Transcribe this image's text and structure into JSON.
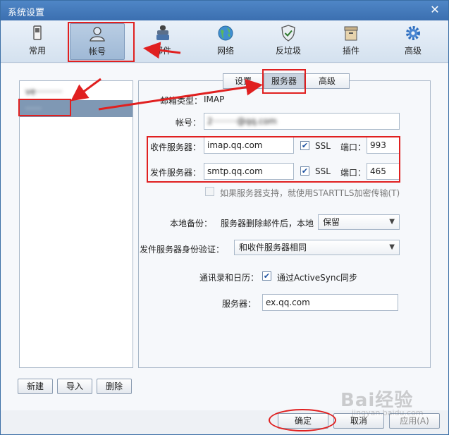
{
  "window": {
    "title": "系统设置"
  },
  "toolbar": {
    "items": [
      {
        "label": "常用",
        "icon": "phone-icon"
      },
      {
        "label": "帐号",
        "icon": "user-icon"
      },
      {
        "label": "邮件",
        "icon": "mail-stamp-icon"
      },
      {
        "label": "网络",
        "icon": "globe-icon"
      },
      {
        "label": "反垃圾",
        "icon": "shield-check-icon"
      },
      {
        "label": "插件",
        "icon": "box-icon"
      },
      {
        "label": "高级",
        "icon": "gear-icon"
      }
    ]
  },
  "accounts": {
    "items": [
      {
        "label": "ve··········"
      },
      {
        "label": "······"
      }
    ],
    "new_label": "新建",
    "import_label": "导入",
    "delete_label": "删除"
  },
  "tabs": [
    {
      "label": "设置"
    },
    {
      "label": "服务器"
    },
    {
      "label": "高级"
    }
  ],
  "server": {
    "mailbox_type_label": "邮箱类型：",
    "mailbox_type_value": "IMAP",
    "account_label": "帐号：",
    "account_value": "2·········@qq.com",
    "incoming_label": "收件服务器：",
    "incoming_value": "imap.qq.com",
    "incoming_ssl_label": "SSL",
    "incoming_port_label": "端口：",
    "incoming_port_value": "993",
    "outgoing_label": "发件服务器：",
    "outgoing_value": "smtp.qq.com",
    "outgoing_ssl_label": "SSL",
    "outgoing_port_label": "端口：",
    "outgoing_port_value": "465",
    "starttls_label": "如果服务器支持，就使用STARTTLS加密传输(T)",
    "backup_label": "本地备份：",
    "backup_desc": "服务器删除邮件后，本地",
    "backup_value": "保留",
    "auth_label": "发件服务器身份验证：",
    "auth_value": "和收件服务器相同",
    "contacts_label": "通讯录和日历：",
    "activesync_label": "通过ActiveSync同步",
    "as_server_label": "服务器：",
    "as_server_value": "ex.qq.com"
  },
  "footer": {
    "ok_label": "确定",
    "cancel_label": "取消",
    "apply_label": "应用(A)"
  },
  "watermark": {
    "brand": "Bai经验",
    "url": "jingyan.baidu.com"
  },
  "colors": {
    "annotation": "#e02020",
    "titlebar": "#3b6fb0",
    "selection": "#7f98b4"
  }
}
